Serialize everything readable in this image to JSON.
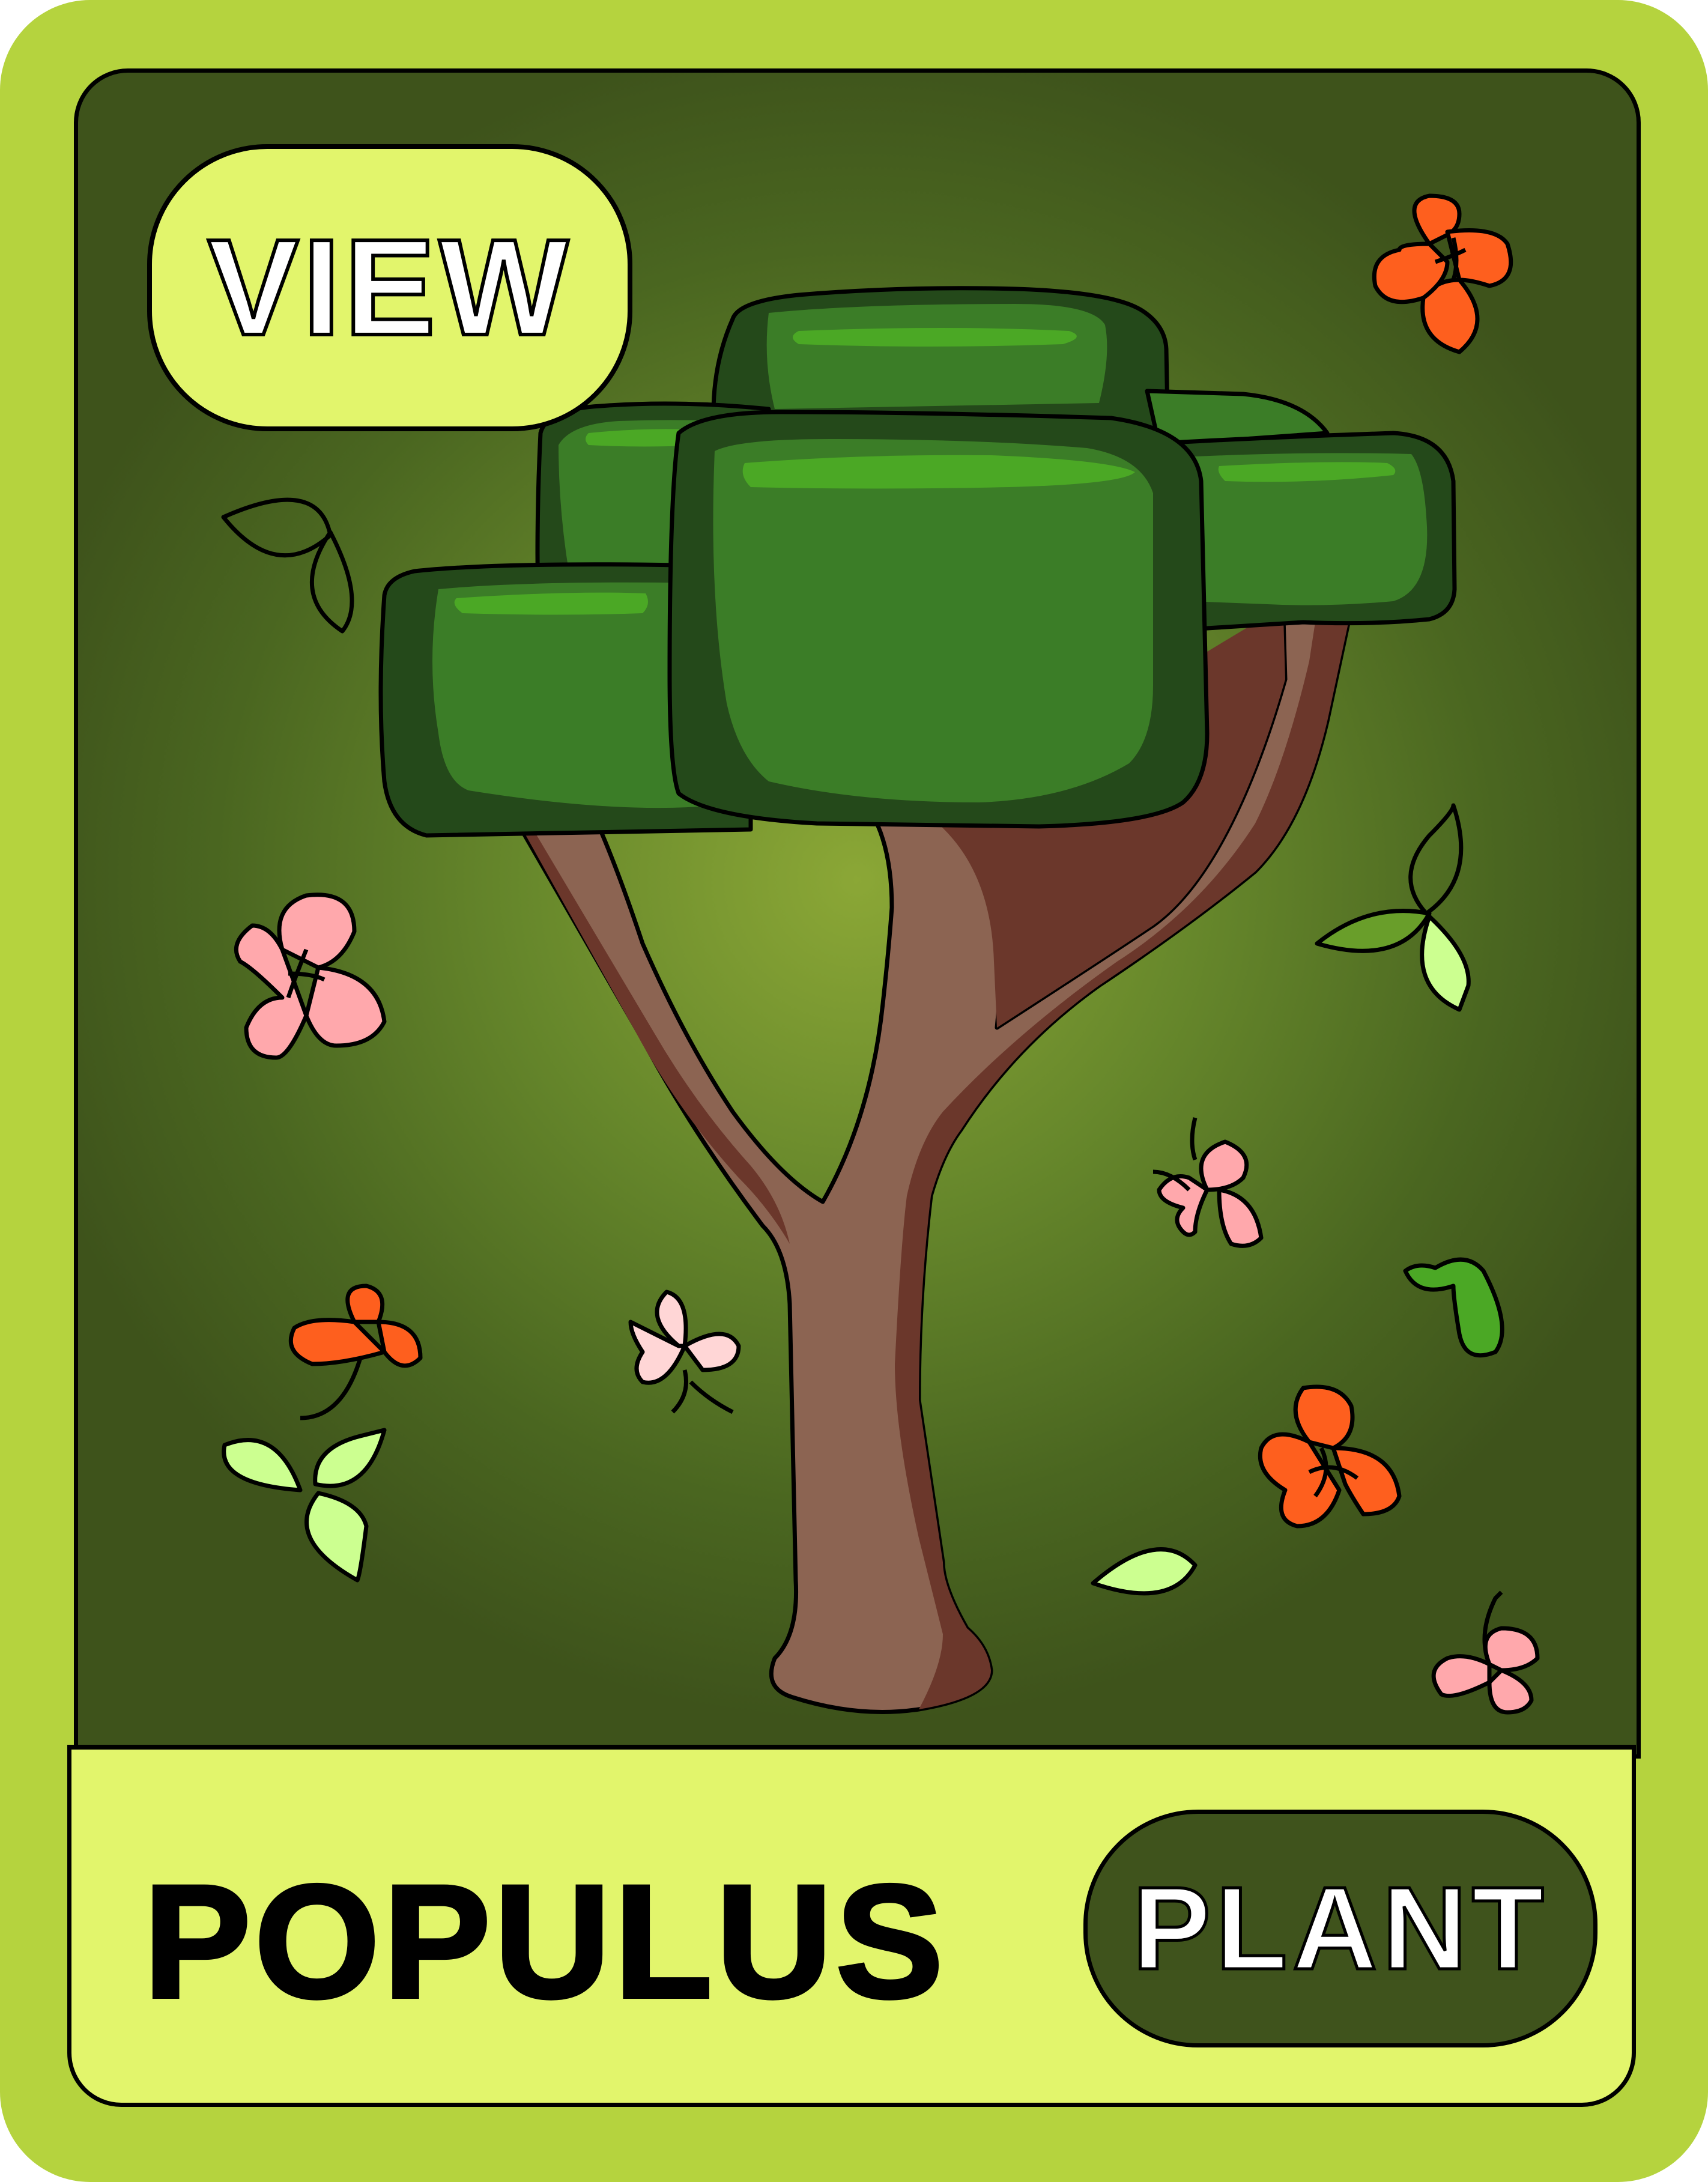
{
  "card": {
    "name": "POPULUS",
    "type_button_label": "PLANT",
    "view_button_label": "VIEW"
  },
  "colors": {
    "frame": "#b5d33e",
    "footer": "#e2f56c",
    "art_center": "#8ba736",
    "art_edge": "#3e531b",
    "plant_button": "#3f531c",
    "leaf_dark": "#24491a",
    "leaf_mid": "#3b7d27",
    "leaf_highlight": "#4ba825",
    "trunk": "#8c6452",
    "trunk_shadow": "#6b372b",
    "flower_orange": "#fe5f1e",
    "flower_pink": "#ffa8ac",
    "flower_light_pink": "#ffd6d6"
  },
  "icons": [
    "tree-illustration",
    "flower-icon",
    "leaf-icon"
  ]
}
